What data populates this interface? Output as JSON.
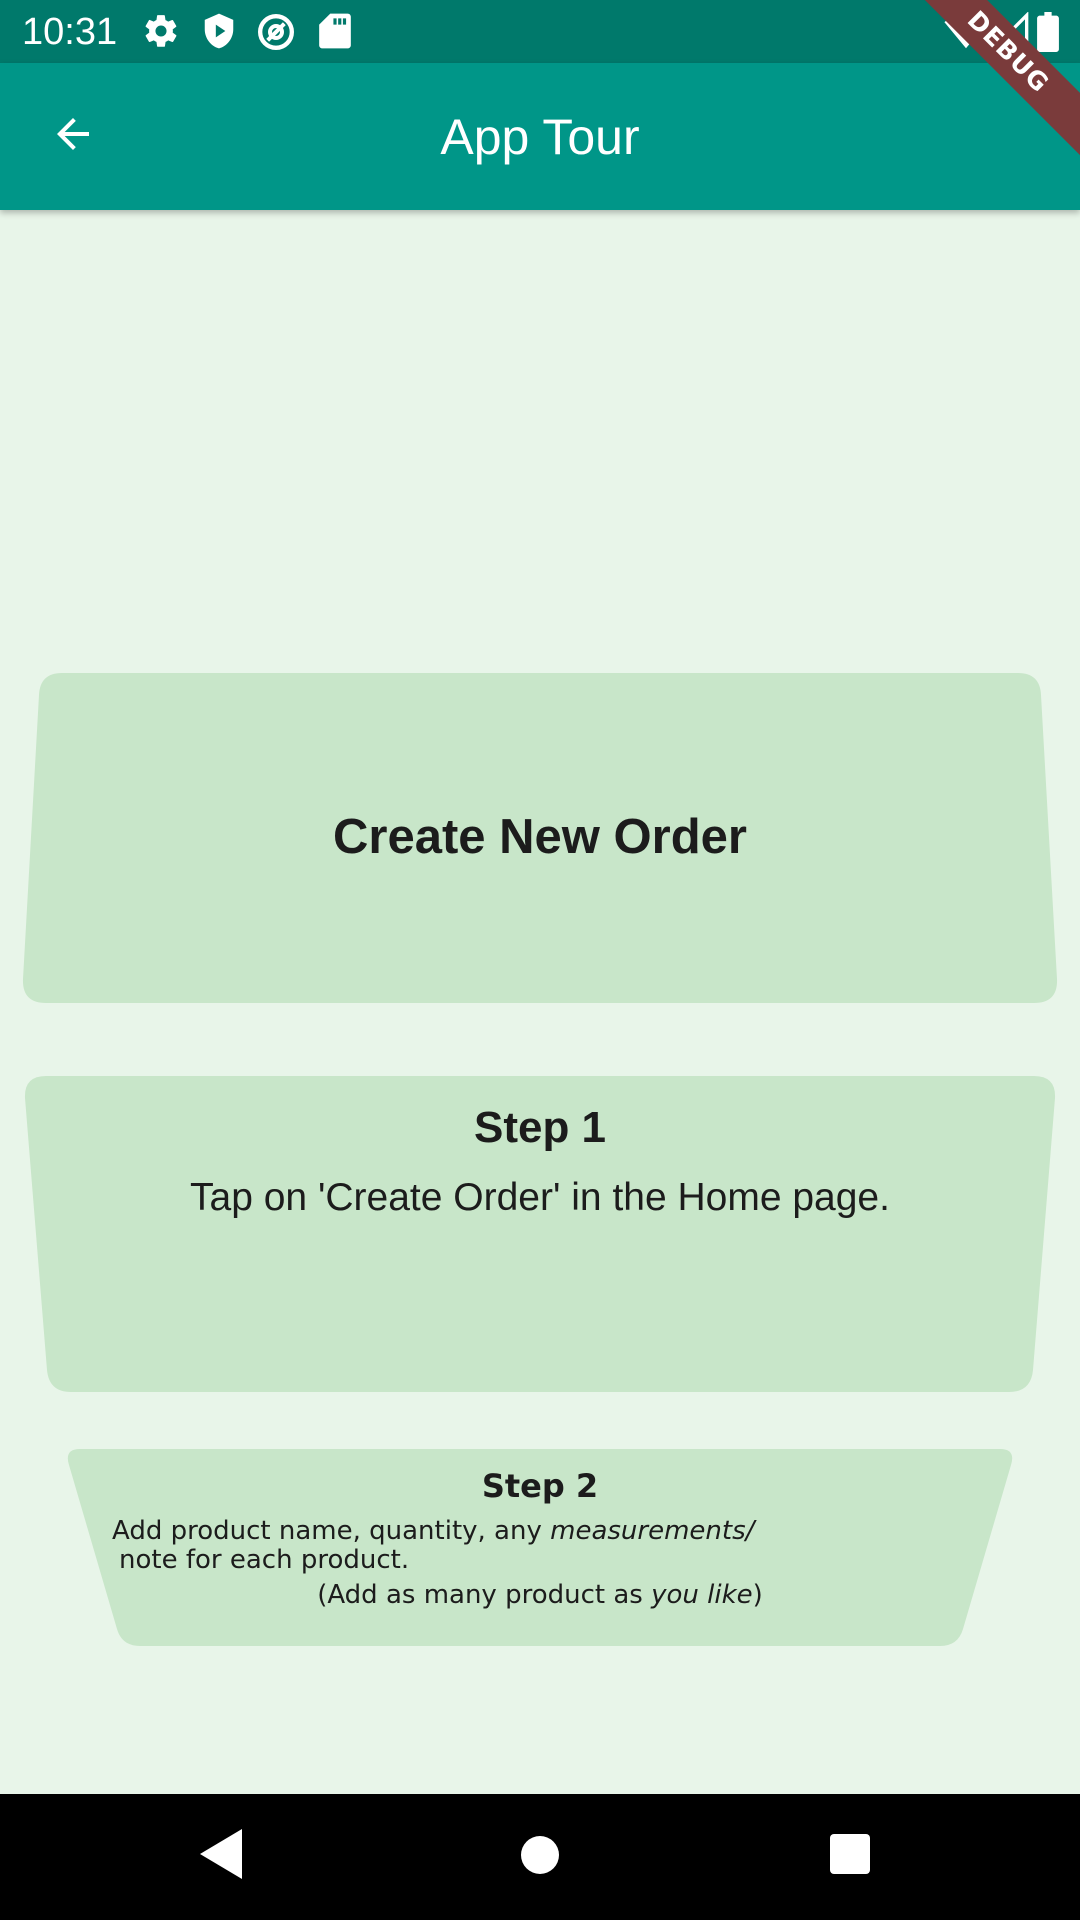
{
  "status_bar": {
    "time": "10:31",
    "icons": [
      "gear-icon",
      "shield-play-icon",
      "at-sign-icon",
      "sd-card-icon",
      "wifi-icon",
      "signal-icon",
      "battery-icon"
    ]
  },
  "debug_banner": "DEBUG",
  "app_bar": {
    "title": "App Tour",
    "back_icon": "arrow-back-icon"
  },
  "cards": {
    "title": {
      "text": "Create New Order"
    },
    "step1": {
      "heading": "Step 1",
      "body": "Tap on 'Create Order' in the Home page."
    },
    "step2": {
      "heading": "Step 2",
      "line1_start": "Add product name, quantity, any ",
      "line1_italic": "measurements/",
      "line2": "note for each product.",
      "line3_start": "(Add as many product as ",
      "line3_italic": "you like",
      "line3_end": ")"
    }
  },
  "nav_bar": {
    "back_icon": "triangle-back-icon",
    "home_icon": "circle-home-icon",
    "recents_icon": "square-recents-icon"
  },
  "colors": {
    "status_bar": "#00796b",
    "app_bar": "#009688",
    "background": "#e8f5e9",
    "card": "#c8e6c9",
    "debug_banner": "#7a3b3b"
  }
}
